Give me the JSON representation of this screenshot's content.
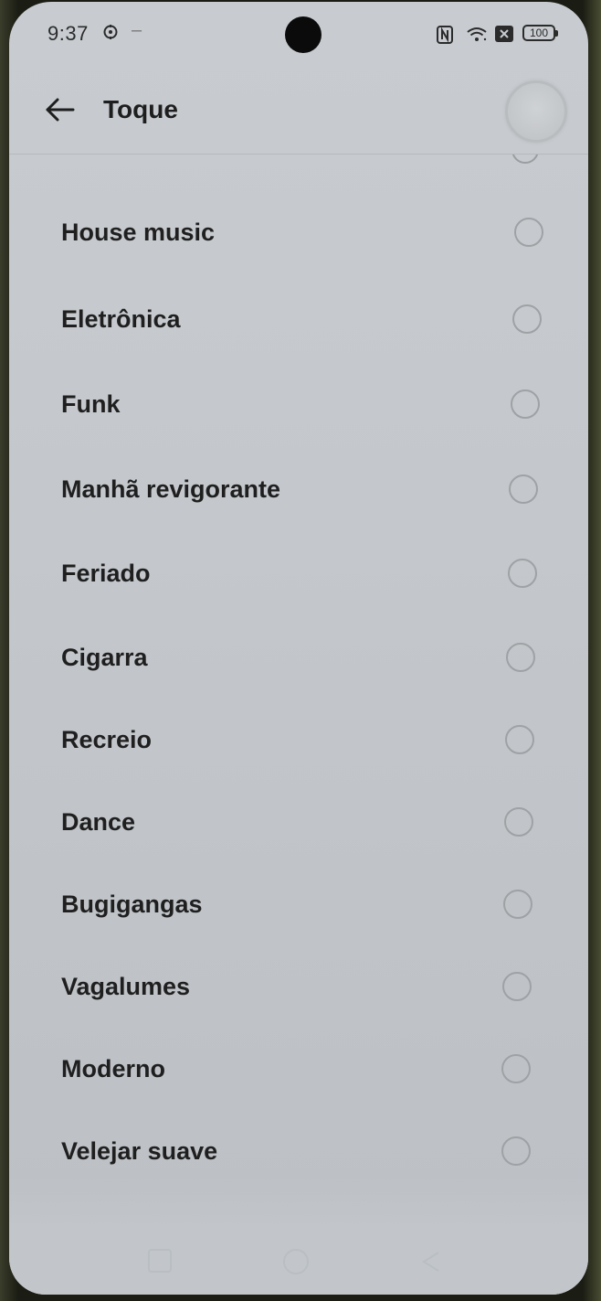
{
  "status_bar": {
    "time": "9:37",
    "dash": "–",
    "battery": "100",
    "icons": [
      "gear-icon",
      "nfc-icon",
      "wifi-icon",
      "sim-off-icon",
      "battery-icon"
    ]
  },
  "header": {
    "title": "Toque",
    "back_icon": "arrow-left-icon",
    "play_icon": "circle-button"
  },
  "ringtones": [
    {
      "label": "House music",
      "selected": false
    },
    {
      "label": "Eletrônica",
      "selected": false
    },
    {
      "label": "Funk",
      "selected": false
    },
    {
      "label": "Manhã revigorante",
      "selected": false
    },
    {
      "label": "Feriado",
      "selected": false
    },
    {
      "label": "Cigarra",
      "selected": false
    },
    {
      "label": "Recreio",
      "selected": false
    },
    {
      "label": "Dance",
      "selected": false
    },
    {
      "label": "Bugigangas",
      "selected": false
    },
    {
      "label": "Vagalumes",
      "selected": false
    },
    {
      "label": "Moderno",
      "selected": false
    },
    {
      "label": "Velejar suave",
      "selected": false
    }
  ],
  "nav_bar": {
    "icons": [
      "menu-icon",
      "home-icon",
      "back-icon"
    ]
  }
}
